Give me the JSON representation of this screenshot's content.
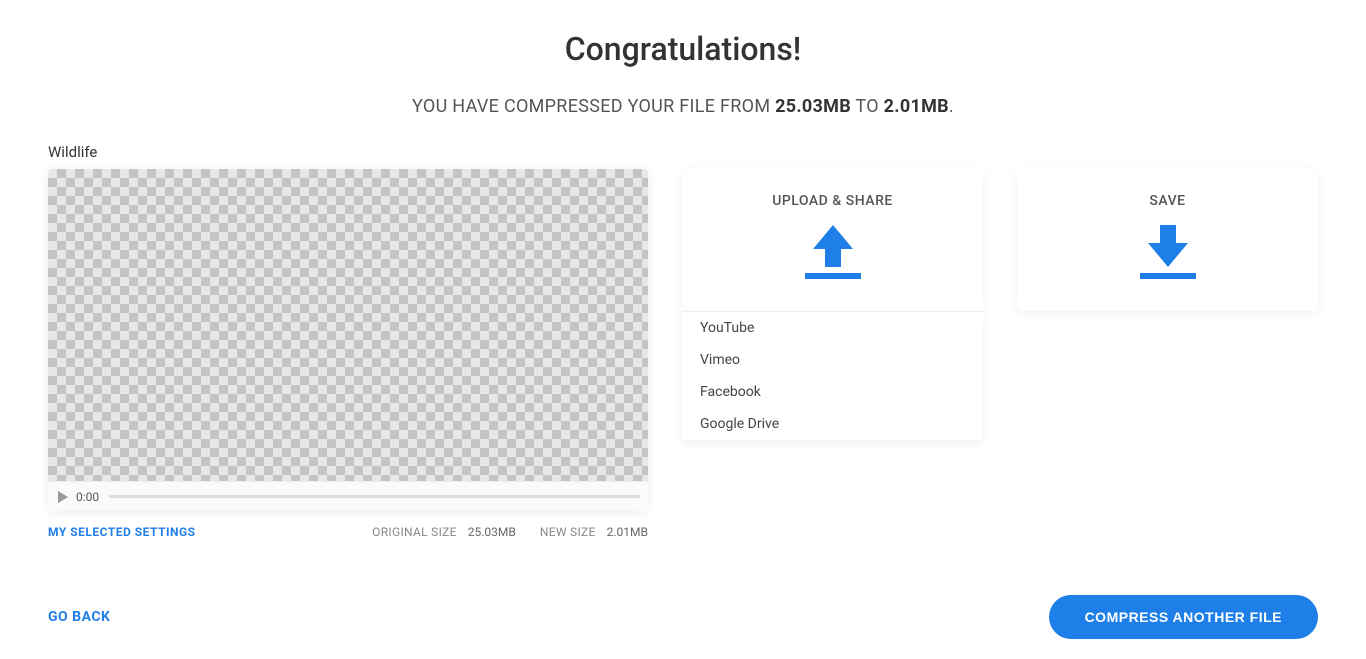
{
  "title": "Congratulations!",
  "subtitle_prefix": "YOU HAVE COMPRESSED YOUR FILE FROM ",
  "subtitle_mid": " TO ",
  "subtitle_suffix": ".",
  "original_size": "25.03MB",
  "new_size": "2.01MB",
  "filename": "Wildlife",
  "player": {
    "time": "0:00"
  },
  "meta": {
    "settings_link": "MY SELECTED SETTINGS",
    "original_label": "ORIGINAL SIZE",
    "original_value": "25.03MB",
    "new_label": "NEW SIZE",
    "new_value": "2.01MB"
  },
  "upload_card": {
    "heading": "UPLOAD & SHARE",
    "options": [
      "YouTube",
      "Vimeo",
      "Facebook",
      "Google Drive"
    ]
  },
  "save_card": {
    "heading": "SAVE"
  },
  "footer": {
    "go_back": "GO BACK",
    "compress_another": "COMPRESS ANOTHER FILE"
  }
}
